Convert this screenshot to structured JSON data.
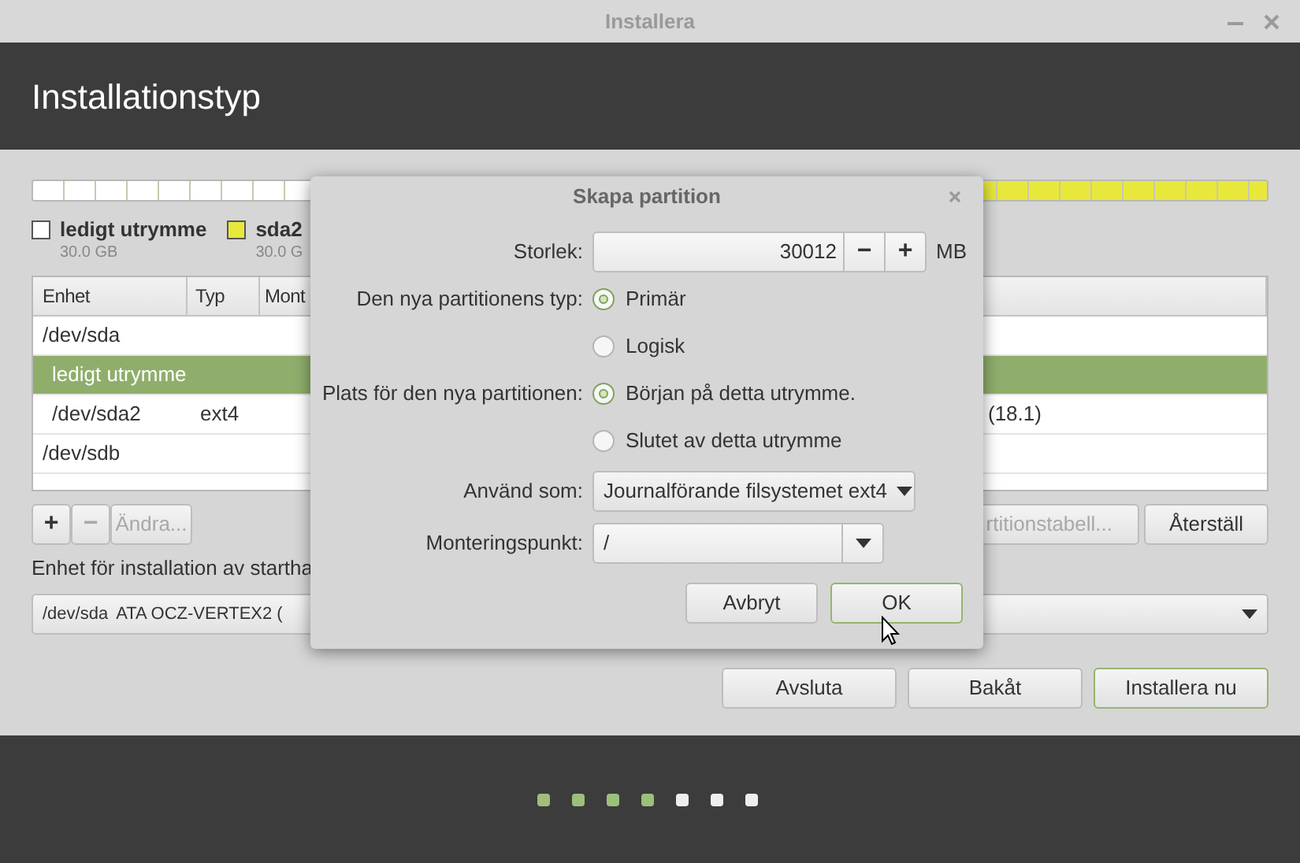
{
  "window": {
    "title": "Installera"
  },
  "header": {
    "title": "Installationstyp"
  },
  "legend": [
    {
      "label": "ledigt utrymme",
      "size": "30.0 GB",
      "color": "#ffffff"
    },
    {
      "label": "sda2",
      "size": "30.0 G",
      "color": "#e8e83c"
    }
  ],
  "table": {
    "columns": [
      "Enhet",
      "Typ",
      "Mont"
    ],
    "rows": [
      {
        "device": "/dev/sda",
        "selected": false,
        "children": [
          {
            "device": "ledigt utrymme",
            "selected": true
          },
          {
            "device": "/dev/sda2",
            "type": "ext4",
            "column_4": "(18.1)",
            "selected": false
          }
        ]
      },
      {
        "device": "/dev/sdb",
        "selected": false
      }
    ]
  },
  "partition_buttons": [
    {
      "label": "+",
      "disabled": false
    },
    {
      "label": "−",
      "disabled": true
    },
    {
      "label": "Ändra...",
      "disabled": true
    }
  ],
  "table_buttons": [
    {
      "label": "rtitionstabell...",
      "disabled": true
    },
    {
      "label": "Återställ",
      "disabled": false
    }
  ],
  "boot_loader": {
    "label": "Enhet för installation av startha",
    "device": "/dev/sda",
    "model": "ATA OCZ-VERTEX2 ("
  },
  "actions": [
    {
      "label": "Avsluta",
      "default": false
    },
    {
      "label": "Bakåt",
      "default": false
    },
    {
      "label": "Installera nu",
      "default": true
    }
  ],
  "progress_steps": [
    {
      "done": true
    },
    {
      "done": true
    },
    {
      "done": true
    },
    {
      "done": true
    },
    {
      "done": false
    },
    {
      "done": false
    },
    {
      "done": false
    }
  ],
  "dialog": {
    "title": "Skapa partition",
    "size": {
      "label": "Storlek:",
      "value": "30012",
      "decrement": "−",
      "increment": "+",
      "unit": "MB"
    },
    "type": {
      "label": "Den nya partitionens typ:",
      "options": [
        {
          "label": "Primär",
          "selected": true
        },
        {
          "label": "Logisk",
          "selected": false
        }
      ]
    },
    "location": {
      "label": "Plats för den nya partitionen:",
      "options": [
        {
          "label": "Början på detta utrymme.",
          "selected": true
        },
        {
          "label": "Slutet av detta utrymme",
          "selected": false
        }
      ]
    },
    "use_as": {
      "label": "Använd som:",
      "value": "Journalförande filsystemet ext4"
    },
    "mount_point": {
      "label": "Monteringspunkt:",
      "value": "/"
    },
    "buttons": [
      {
        "label": "Avbryt",
        "default": false
      },
      {
        "label": "OK",
        "default": true
      }
    ]
  }
}
